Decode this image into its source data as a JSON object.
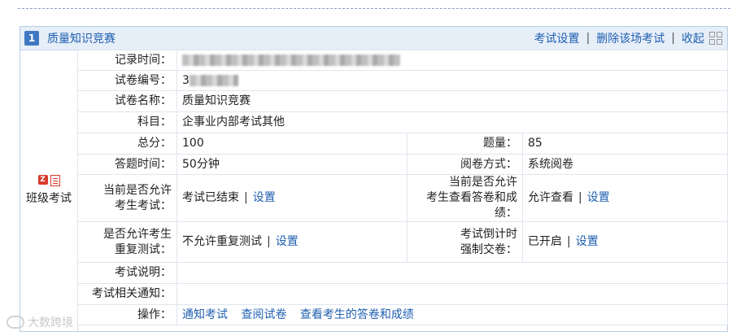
{
  "panel": {
    "number": "1",
    "title": "质量知识竞赛",
    "actions": {
      "settings": "考试设置",
      "delete": "删除该场考试",
      "collapse": "收起",
      "sep": "|"
    }
  },
  "side": {
    "label": "班级考试",
    "icon_letter": "Z"
  },
  "rows": {
    "record_time_label": "记录时间：",
    "paper_no_label": "试卷编号：",
    "paper_no_value": "3",
    "paper_name_label": "试卷名称：",
    "paper_name_value": "质量知识竞赛",
    "subject_label": "科目：",
    "subject_value": "企事业内部考试其他",
    "score_label": "总分：",
    "score_value": "100",
    "qcount_label": "题量：",
    "qcount_value": "85",
    "duration_label": "答题时间：",
    "duration_value": "50分钟",
    "grading_label": "阅卷方式：",
    "grading_value": "系统阅卷",
    "allow_exam_label_1": "当前是否允许",
    "allow_exam_label_2": "考生考试：",
    "allow_exam_value": "考试已结束",
    "allow_view_label_1": "当前是否允许",
    "allow_view_label_2": "考生查看答卷和成绩：",
    "allow_view_value": "允许查看",
    "retest_label_1": "是否允许考生",
    "retest_label_2": "重复测试：",
    "retest_value": "不允许重复测试",
    "countdown_label_1": "考试倒计时",
    "countdown_label_2": "强制交卷：",
    "countdown_value": "已开启",
    "set_link": "设置",
    "sep": "|",
    "desc_label": "考试说明：",
    "notice_label": "考试相关通知：",
    "ops_label": "操作：",
    "op_notify": "通知考试",
    "op_review": "查阅试卷",
    "op_view_answers": "查看考生的答卷和成绩"
  },
  "watermark": "大数跨境"
}
